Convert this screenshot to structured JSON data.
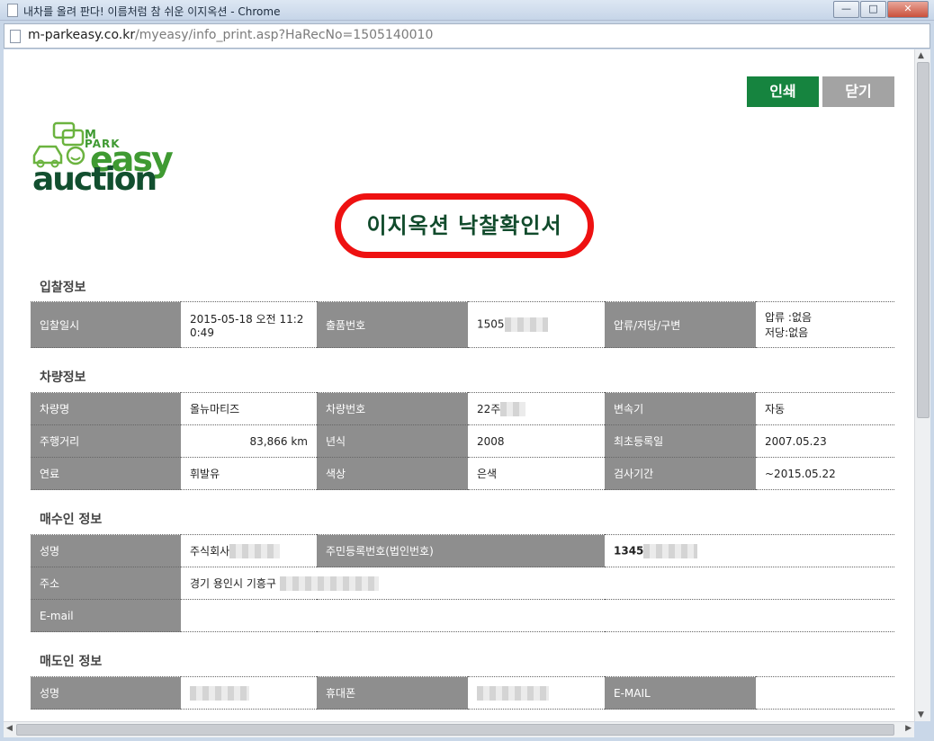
{
  "window": {
    "title": "내차를 올려 판다! 이름처럼 참 쉬운 이지옥션 - Chrome",
    "url_host": "m-parkeasy.co.kr",
    "url_path": "/myeasy/info_print.asp?HaRecNo=1505140010",
    "icons": [
      "page-icon",
      "minimize-icon",
      "maximize-icon",
      "close-icon"
    ]
  },
  "toolbar": {
    "print_label": "인쇄",
    "close_label": "닫기"
  },
  "logo": {
    "m": "M",
    "park": "PARK",
    "easy": "easy",
    "auction": "auction"
  },
  "document": {
    "title": "이지옥션 낙찰확인서",
    "highlight_color": "#ee1111"
  },
  "bid_info": {
    "section_title": "입찰정보",
    "bid_datetime_label": "입찰일시",
    "bid_datetime_value": "2015-05-18 오전 11:2 0:49",
    "listing_no_label": "출품번호",
    "listing_no_value": "1505",
    "seizure_label": "압류/저당/구변",
    "seizure_value": "압류 :없음",
    "mortgage_value": "저당:없음"
  },
  "vehicle_info": {
    "section_title": "차량정보",
    "rows": [
      [
        {
          "label": "차량명",
          "value": "올뉴마티즈"
        },
        {
          "label": "차량번호",
          "value": "22주"
        },
        {
          "label": "변속기",
          "value": "자동"
        }
      ],
      [
        {
          "label": "주행거리",
          "value": "83,866 km"
        },
        {
          "label": "년식",
          "value": "2008"
        },
        {
          "label": "최초등록일",
          "value": "2007.05.23"
        }
      ],
      [
        {
          "label": "연료",
          "value": "휘발유"
        },
        {
          "label": "색상",
          "value": "은색"
        },
        {
          "label": "검사기간",
          "value": "~2015.05.22"
        }
      ]
    ]
  },
  "buyer_info": {
    "section_title": "매수인 정보",
    "name_label": "성명",
    "name_value": "주식회사",
    "reg_no_label": "주민등록번호(법인번호)",
    "reg_no_value": "1345",
    "address_label": "주소",
    "address_value": "경기 용인시 기흥구",
    "email_label": "E-mail",
    "email_value": ""
  },
  "seller_info": {
    "section_title": "매도인 정보",
    "name_label": "성명",
    "phone_label": "휴대폰",
    "email_label": "E-MAIL",
    "email_value": ""
  },
  "colors": {
    "primary_green": "#16843f",
    "header_gray": "#8e8e8e",
    "brand_dark_green": "#124f2f"
  }
}
